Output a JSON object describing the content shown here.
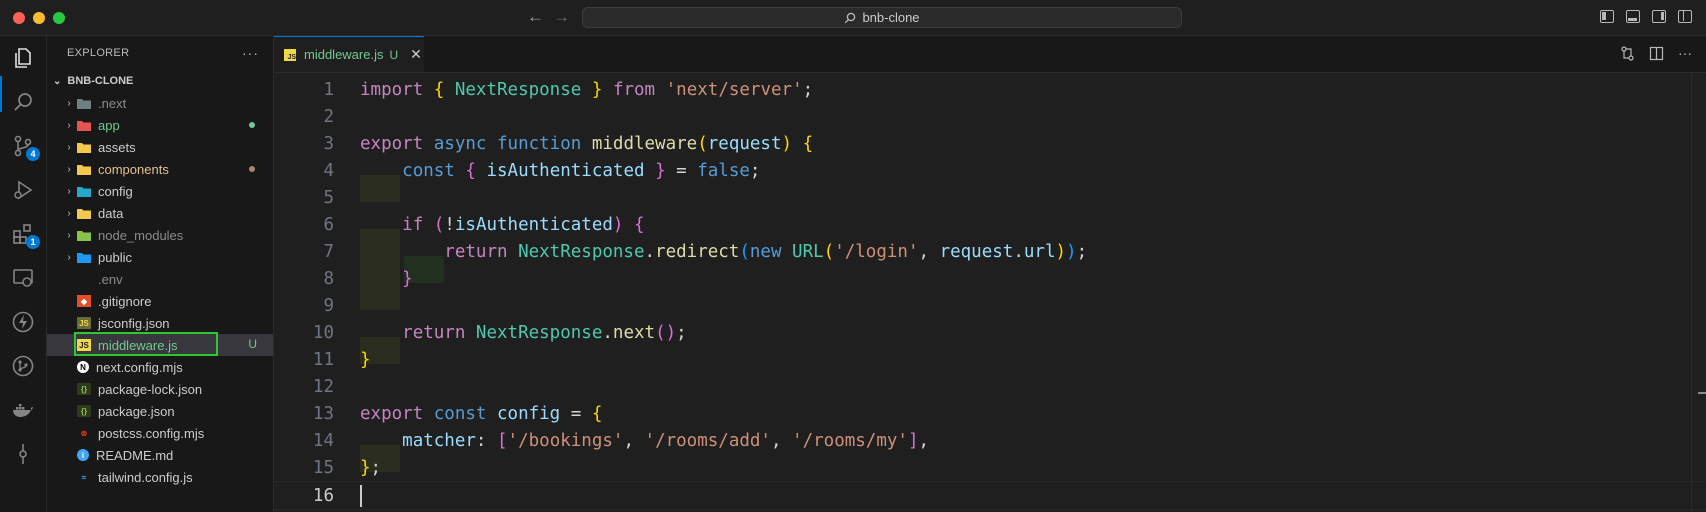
{
  "window": {
    "search_text": "bnb-clone"
  },
  "activity_bar": {
    "items": [
      {
        "name": "explorer-icon"
      },
      {
        "name": "search-icon"
      },
      {
        "name": "source-control-icon",
        "badge": "4"
      },
      {
        "name": "run-debug-icon"
      },
      {
        "name": "extensions-icon",
        "badge": "1"
      },
      {
        "name": "remote-explorer-icon"
      },
      {
        "name": "thunder-client-icon"
      },
      {
        "name": "git-graph-icon"
      },
      {
        "name": "docker-icon"
      },
      {
        "name": "timeline-icon"
      }
    ]
  },
  "sidebar": {
    "title": "EXPLORER",
    "more": "···",
    "project": "BNB-CLONE",
    "folders": [
      {
        "label": ".next",
        "color": "#8b8b8b",
        "icon_color": "#6d8086"
      },
      {
        "label": "app",
        "color": "#73c991",
        "icon_color": "#e55353",
        "dot": "#73c991"
      },
      {
        "label": "assets",
        "color": "#cccccc",
        "icon_color": "#f2c94c"
      },
      {
        "label": "components",
        "color": "#e2c08d",
        "icon_color": "#f2c94c",
        "dot": "#a68a64"
      },
      {
        "label": "config",
        "color": "#cccccc",
        "icon_color": "#26a8c9"
      },
      {
        "label": "data",
        "color": "#cccccc",
        "icon_color": "#f2c94c"
      },
      {
        "label": "node_modules",
        "color": "#8b8b8b",
        "icon_color": "#8bc34a"
      },
      {
        "label": "public",
        "color": "#cccccc",
        "icon_color": "#2196f3"
      }
    ],
    "files": [
      {
        "label": ".env",
        "color": "#8b8b8b",
        "icon": "env-file-icon"
      },
      {
        "label": ".gitignore",
        "color": "#cccccc",
        "icon": "git-file-icon"
      },
      {
        "label": "jsconfig.json",
        "color": "#cccccc",
        "icon": "js-config-icon"
      },
      {
        "label": "middleware.js",
        "color": "#73c991",
        "icon": "javascript-file-icon",
        "status": "U",
        "selected": true
      },
      {
        "label": "next.config.mjs",
        "color": "#cccccc",
        "icon": "next-file-icon"
      },
      {
        "label": "package-lock.json",
        "color": "#cccccc",
        "icon": "npm-file-icon"
      },
      {
        "label": "package.json",
        "color": "#cccccc",
        "icon": "npm-file-icon"
      },
      {
        "label": "postcss.config.mjs",
        "color": "#cccccc",
        "icon": "postcss-file-icon"
      },
      {
        "label": "README.md",
        "color": "#cccccc",
        "icon": "info-file-icon"
      },
      {
        "label": "tailwind.config.js",
        "color": "#cccccc",
        "icon": "tailwind-file-icon"
      }
    ]
  },
  "editor": {
    "tab": {
      "label": "middleware.js",
      "status": "U",
      "close": "✕"
    },
    "current_line": 16,
    "lines": [
      {
        "n": "1",
        "tokens": [
          [
            "kw",
            "import"
          ],
          [
            "pl",
            " "
          ],
          [
            "br1",
            "{"
          ],
          [
            "pl",
            " "
          ],
          [
            "cls",
            "NextResponse"
          ],
          [
            "pl",
            " "
          ],
          [
            "br1",
            "}"
          ],
          [
            "pl",
            " "
          ],
          [
            "kw",
            "from"
          ],
          [
            "pl",
            " "
          ],
          [
            "str",
            "'next/server'"
          ],
          [
            "pl",
            ";"
          ]
        ]
      },
      {
        "n": "2",
        "tokens": []
      },
      {
        "n": "3",
        "tokens": [
          [
            "kw",
            "export"
          ],
          [
            "pl",
            " "
          ],
          [
            "kwb",
            "async"
          ],
          [
            "pl",
            " "
          ],
          [
            "kwb",
            "function"
          ],
          [
            "pl",
            " "
          ],
          [
            "fn",
            "middleware"
          ],
          [
            "br1",
            "("
          ],
          [
            "var",
            "request"
          ],
          [
            "br1",
            ")"
          ],
          [
            "pl",
            " "
          ],
          [
            "br1",
            "{"
          ]
        ]
      },
      {
        "n": "4",
        "tokens": [
          [
            "pl",
            "    "
          ],
          [
            "kwb",
            "const"
          ],
          [
            "pl",
            " "
          ],
          [
            "br2",
            "{"
          ],
          [
            "pl",
            " "
          ],
          [
            "var",
            "isAuthenticated"
          ],
          [
            "pl",
            " "
          ],
          [
            "br2",
            "}"
          ],
          [
            "pl",
            " = "
          ],
          [
            "kwb",
            "false"
          ],
          [
            "pl",
            ";"
          ]
        ]
      },
      {
        "n": "5",
        "tokens": []
      },
      {
        "n": "6",
        "tokens": [
          [
            "pl",
            "    "
          ],
          [
            "kw",
            "if"
          ],
          [
            "pl",
            " "
          ],
          [
            "br2",
            "("
          ],
          [
            "pl",
            "!"
          ],
          [
            "var",
            "isAuthenticated"
          ],
          [
            "br2",
            ")"
          ],
          [
            "pl",
            " "
          ],
          [
            "br2",
            "{"
          ]
        ]
      },
      {
        "n": "7",
        "tokens": [
          [
            "pl",
            "        "
          ],
          [
            "kw",
            "return"
          ],
          [
            "pl",
            " "
          ],
          [
            "cls",
            "NextResponse"
          ],
          [
            "pl",
            "."
          ],
          [
            "fn",
            "redirect"
          ],
          [
            "br3",
            "("
          ],
          [
            "kwb",
            "new"
          ],
          [
            "pl",
            " "
          ],
          [
            "cls",
            "URL"
          ],
          [
            "br1",
            "("
          ],
          [
            "str",
            "'/login'"
          ],
          [
            "pl",
            ", "
          ],
          [
            "var",
            "request"
          ],
          [
            "pl",
            "."
          ],
          [
            "var",
            "url"
          ],
          [
            "br1",
            ")"
          ],
          [
            "br3",
            ")"
          ],
          [
            "pl",
            ";"
          ]
        ]
      },
      {
        "n": "8",
        "tokens": [
          [
            "pl",
            "    "
          ],
          [
            "br2",
            "}"
          ]
        ]
      },
      {
        "n": "9",
        "tokens": []
      },
      {
        "n": "10",
        "tokens": [
          [
            "pl",
            "    "
          ],
          [
            "kw",
            "return"
          ],
          [
            "pl",
            " "
          ],
          [
            "cls",
            "NextResponse"
          ],
          [
            "pl",
            "."
          ],
          [
            "fn",
            "next"
          ],
          [
            "br2",
            "()"
          ],
          [
            "pl",
            ";"
          ]
        ]
      },
      {
        "n": "11",
        "tokens": [
          [
            "br1",
            "}"
          ]
        ]
      },
      {
        "n": "12",
        "tokens": []
      },
      {
        "n": "13",
        "tokens": [
          [
            "kw",
            "export"
          ],
          [
            "pl",
            " "
          ],
          [
            "kwb",
            "const"
          ],
          [
            "pl",
            " "
          ],
          [
            "var",
            "config"
          ],
          [
            "pl",
            " = "
          ],
          [
            "br1",
            "{"
          ]
        ]
      },
      {
        "n": "14",
        "tokens": [
          [
            "pl",
            "    "
          ],
          [
            "var",
            "matcher"
          ],
          [
            "pl",
            ": "
          ],
          [
            "br2",
            "["
          ],
          [
            "str",
            "'/bookings'"
          ],
          [
            "pl",
            ", "
          ],
          [
            "str",
            "'/rooms/add'"
          ],
          [
            "pl",
            ", "
          ],
          [
            "str",
            "'/rooms/my'"
          ],
          [
            "br2",
            "]"
          ],
          [
            "pl",
            ","
          ]
        ]
      },
      {
        "n": "15",
        "tokens": [
          [
            "br1",
            "}"
          ],
          [
            "pl",
            ";"
          ]
        ]
      },
      {
        "n": "16",
        "tokens": []
      }
    ]
  }
}
